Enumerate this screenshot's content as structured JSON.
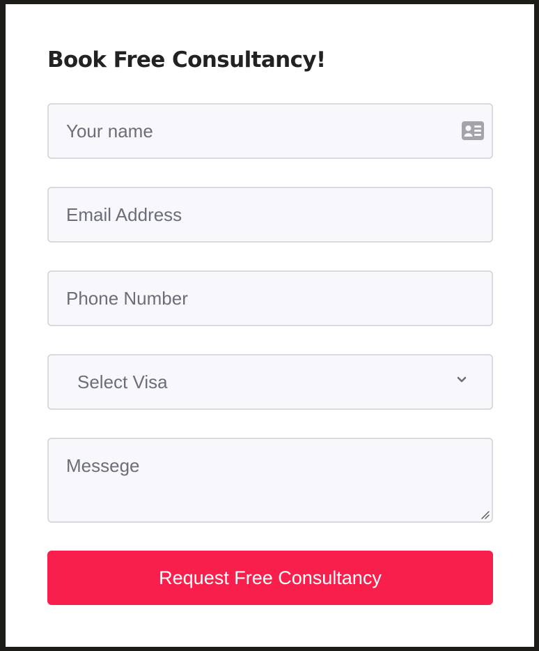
{
  "form": {
    "title": "Book Free Consultancy!",
    "name_placeholder": "Your name",
    "email_placeholder": "Email Address",
    "phone_placeholder": "Phone Number",
    "visa_selected": "Select Visa",
    "message_placeholder": "Messege",
    "submit_label": "Request Free Consultancy"
  },
  "icons": {
    "name_field": "id-card-icon",
    "visa_select": "chevron-down-icon",
    "message_resize": "resize-handle-icon"
  },
  "colors": {
    "accent": "#f91f4d",
    "field_background": "#f8f8fc",
    "field_border": "#d9d9e0",
    "placeholder_text": "#6b6e78",
    "heading_text": "#222222"
  }
}
